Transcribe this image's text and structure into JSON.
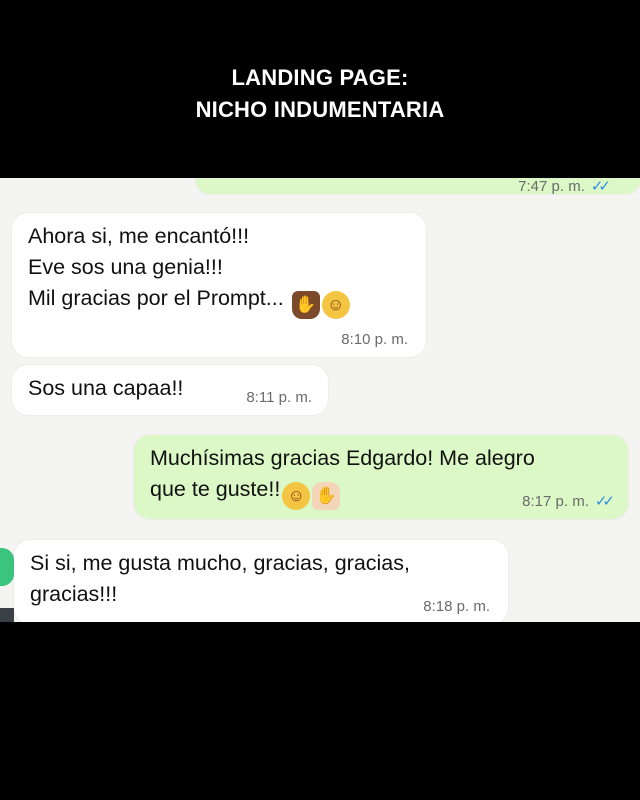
{
  "header": {
    "title_line1": "LANDING PAGE:",
    "title_line2": "NICHO INDUMENTARIA"
  },
  "messages": [
    {
      "direction": "outgoing",
      "text": "",
      "time": "7:47 p. m.",
      "read": true
    },
    {
      "direction": "incoming",
      "lines": [
        "Ahora si, me encantó!!!",
        "Eve sos una genia!!!",
        "Mil gracias por el Prompt..."
      ],
      "emojis": [
        "raising-hands-emoji",
        "partying-face-emoji"
      ],
      "time": "8:10 p. m."
    },
    {
      "direction": "incoming",
      "text": "Sos una capaa!!",
      "time": "8:11 p. m."
    },
    {
      "direction": "outgoing",
      "lines": [
        "Muchísimas gracias Edgardo! Me alegro",
        "que te guste!!"
      ],
      "emojis": [
        "smiling-face-emoji",
        "folded-hands-emoji"
      ],
      "time": "8:17 p. m.",
      "read": true
    },
    {
      "direction": "incoming",
      "lines": [
        "Si si,  me gusta mucho, gracias, gracias,",
        "gracias!!!"
      ],
      "time": "8:18 p. m."
    }
  ],
  "colors": {
    "outgoing_bubble": "#dcf8c6",
    "incoming_bubble": "#ffffff",
    "chat_background": "#f4f4f2",
    "read_ticks": "#2f8fe0"
  }
}
